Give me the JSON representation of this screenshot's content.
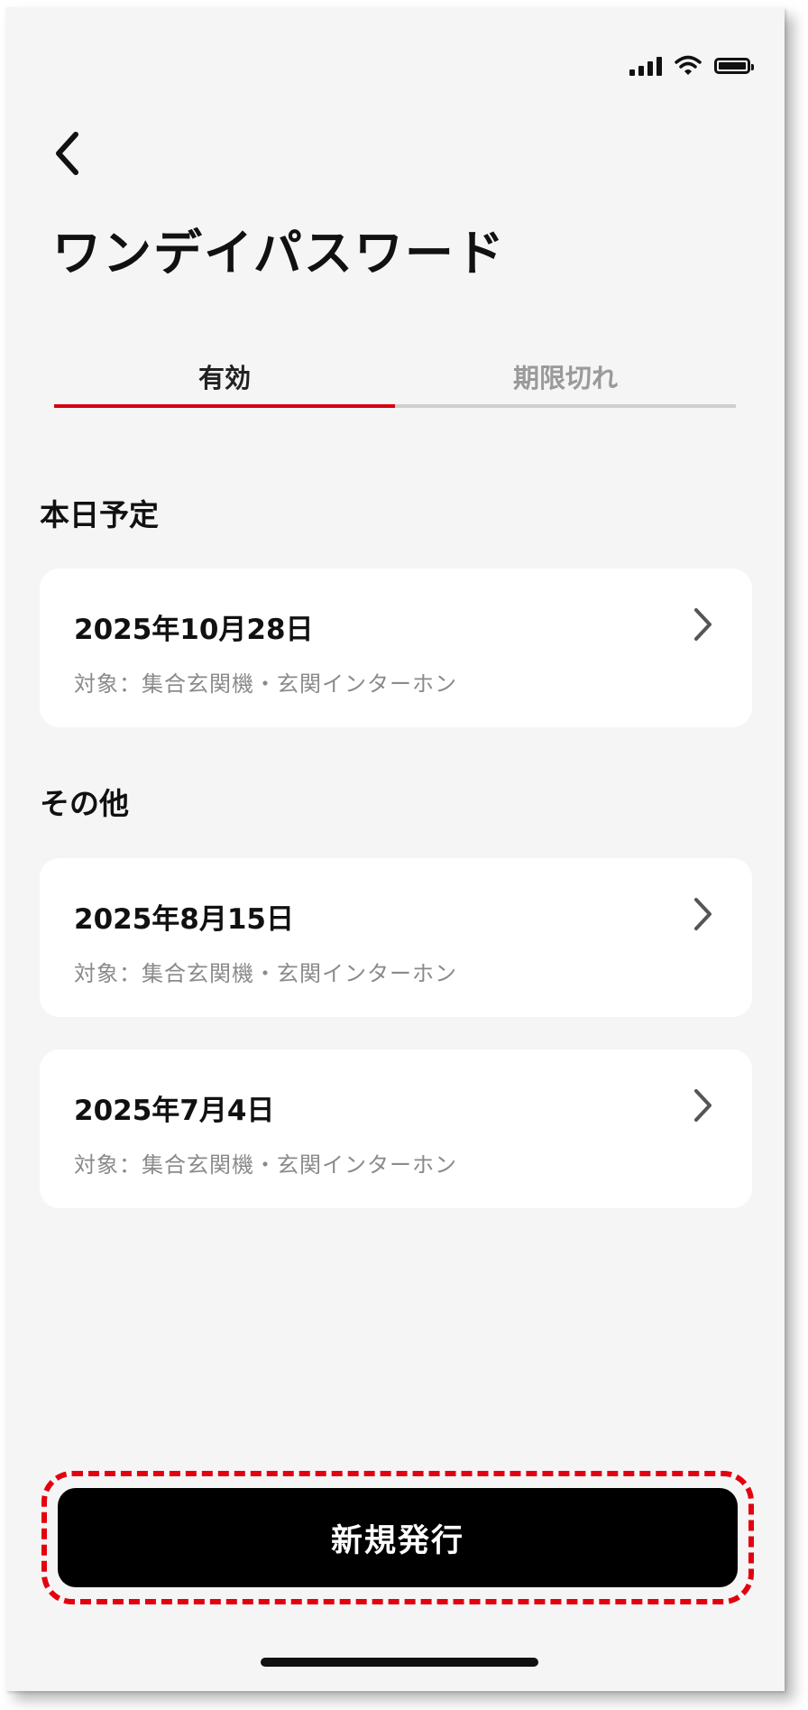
{
  "header": {
    "title": "ワンデイパスワード"
  },
  "tabs": [
    {
      "label": "有効",
      "active": true
    },
    {
      "label": "期限切れ",
      "active": false
    }
  ],
  "sections": {
    "today": {
      "heading": "本日予定",
      "items": [
        {
          "date": "2025年10月28日",
          "target": "対象：集合玄関機・玄関インターホン"
        }
      ]
    },
    "other": {
      "heading": "その他",
      "items": [
        {
          "date": "2025年8月15日",
          "target": "対象：集合玄関機・玄関インターホン"
        },
        {
          "date": "2025年7月4日",
          "target": "対象：集合玄関機・玄関インターホン"
        }
      ]
    }
  },
  "footer": {
    "issue_label": "新規発行"
  },
  "colors": {
    "accent": "#d7000f",
    "highlight_border": "#e3000f",
    "background": "#f5f5f5",
    "card": "#ffffff",
    "button": "#000000"
  },
  "icons": {
    "back": "chevron-left-icon",
    "item": "chevron-right-icon",
    "status": [
      "signal-icon",
      "wifi-icon",
      "battery-icon"
    ]
  }
}
